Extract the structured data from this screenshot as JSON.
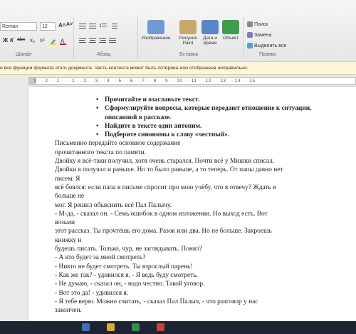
{
  "ribbon": {
    "font_name": "Roman",
    "font_size": "12",
    "grow_font": "A˄",
    "shrink_font": "A˅",
    "bold": "Ж",
    "italic": "К",
    "strike": "abc",
    "subscript": "x₂",
    "superscript": "x²",
    "groups": {
      "font": "Шрифт",
      "paragraph": "Абзац",
      "insert": "Вставка",
      "editing": "Правка"
    },
    "insert_buttons": [
      {
        "label": "Изображение",
        "icon": "image-icon"
      },
      {
        "label": "Рисунок Paint",
        "icon": "paint-icon"
      },
      {
        "label": "Дата и время",
        "icon": "calendar-icon"
      },
      {
        "label": "Объект",
        "icon": "object-icon"
      }
    ],
    "editing_buttons": {
      "find": "Поиск",
      "replace": "Замена",
      "select_all": "Выделить все"
    }
  },
  "warning": "е все функции формата этого документа. Часть контента может быть потеряна или отображена неправильно.",
  "ruler": "3 · · 2 · · 1 · · · 1 · · 2 · · 3 · · 4 · · 5 · · 6 · · 7 · · 8 · · 9 · · 10 · · 11 · · 12 · · 13 · · 14 · · 15",
  "document": {
    "bullets": [
      "Прочитайте и озаглавьте текст.",
      "Сформулируйте вопросы, которые передают отношение к ситуации, описанной в рассказе.",
      "Найдите в тексте один антоним.",
      "Подберите синонимы к слову «честный»."
    ],
    "paragraphs": [
      "Письменно передайте основное содержание",
      "прочитанного текста по памяти.",
      "Двойку я всё-таки получил, хотя очень старался. Почти всё у Мишки списал.",
      "Двойки я получал и раньше. Но то было раньше, а то теперь. От папы давно нет",
      "писем. Я",
      "всё боялся: если папа в письме спросит про мою учёбу, что я отвечу? Ждать я",
      "больше не",
      "мог. Я решил объяснить всё Пал Палычу.",
      "- М-да, - сказал он. - Семь ошибок в одном изложении. Но выход есть. Вот",
      "возьми",
      "этот рассказ. Ты прочтёшь его дома. Разок или два. Но не больше. Закроешь",
      "книжку и",
      "будешь писать. Только, чур, не заглядывать. Понял?",
      "- А кто будет за мной смотреть?",
      "- Никто не будет смотреть. Ты взрослый парень!",
      "- Как же так? - удивился я. - Я ведь буду смотреть.",
      "- Не думаю, - сказал он, - надо честно. Такой уговор.",
      "- Вот это да! - удивился я.",
      "- Я тебе верю. Можно считать, - сказал Пал Палыч, - что разговор у нас",
      "закончен."
    ]
  }
}
